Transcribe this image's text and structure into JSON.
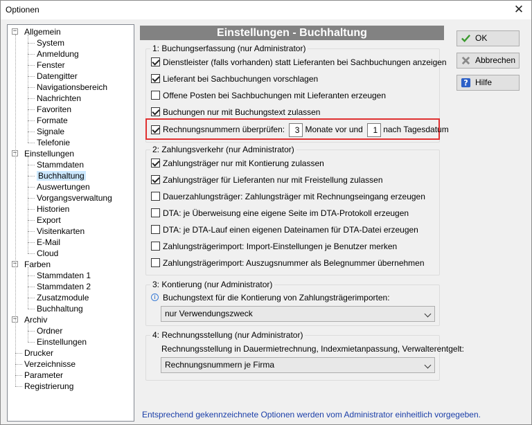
{
  "window": {
    "title": "Optionen",
    "close_glyph": "✕"
  },
  "tree": {
    "items": [
      {
        "label": "Allgemein",
        "level": 0,
        "expander": "−"
      },
      {
        "label": "System",
        "level": 1
      },
      {
        "label": "Anmeldung",
        "level": 1
      },
      {
        "label": "Fenster",
        "level": 1
      },
      {
        "label": "Datengitter",
        "level": 1
      },
      {
        "label": "Navigationsbereich",
        "level": 1
      },
      {
        "label": "Nachrichten",
        "level": 1
      },
      {
        "label": "Favoriten",
        "level": 1
      },
      {
        "label": "Formate",
        "level": 1
      },
      {
        "label": "Signale",
        "level": 1
      },
      {
        "label": "Telefonie",
        "level": 1
      },
      {
        "label": "Einstellungen",
        "level": 0,
        "expander": "−"
      },
      {
        "label": "Stammdaten",
        "level": 1
      },
      {
        "label": "Buchhaltung",
        "level": 1,
        "selected": true
      },
      {
        "label": "Auswertungen",
        "level": 1
      },
      {
        "label": "Vorgangsverwaltung",
        "level": 1
      },
      {
        "label": "Historien",
        "level": 1
      },
      {
        "label": "Export",
        "level": 1
      },
      {
        "label": "Visitenkarten",
        "level": 1
      },
      {
        "label": "E-Mail",
        "level": 1
      },
      {
        "label": "Cloud",
        "level": 1
      },
      {
        "label": "Farben",
        "level": 0,
        "expander": "−"
      },
      {
        "label": "Stammdaten 1",
        "level": 1
      },
      {
        "label": "Stammdaten 2",
        "level": 1
      },
      {
        "label": "Zusatzmodule",
        "level": 1
      },
      {
        "label": "Buchhaltung",
        "level": 1
      },
      {
        "label": "Archiv",
        "level": 0,
        "expander": "−"
      },
      {
        "label": "Ordner",
        "level": 1
      },
      {
        "label": "Einstellungen",
        "level": 1
      },
      {
        "label": "Drucker",
        "level": 0
      },
      {
        "label": "Verzeichnisse",
        "level": 0
      },
      {
        "label": "Parameter",
        "level": 0
      },
      {
        "label": "Registrierung",
        "level": 0
      }
    ]
  },
  "panel": {
    "title": "Einstellungen - Buchhaltung"
  },
  "group1": {
    "title": "1: Buchungserfassung  (nur Administrator)",
    "options": [
      {
        "label": "Dienstleister (falls vorhanden) statt Lieferanten bei Sachbuchungen anzeigen",
        "checked": true
      },
      {
        "label": "Lieferant bei Sachbuchungen vorschlagen",
        "checked": true
      },
      {
        "label": "Offene Posten bei Sachbuchungen mit Lieferanten erzeugen",
        "checked": false
      },
      {
        "label": "Buchungen nur mit Buchungstext zulassen",
        "checked": true
      }
    ],
    "check_row": {
      "label": "Rechnungsnummern überprüfen:",
      "checked": true,
      "months_before": "3",
      "mid_text": "Monate vor und",
      "months_after": "1",
      "end_text": "nach Tagesdatum"
    }
  },
  "group2": {
    "title": "2: Zahlungsverkehr  (nur Administrator)",
    "options": [
      {
        "label": "Zahlungsträger nur mit Kontierung zulassen",
        "checked": true
      },
      {
        "label": "Zahlungsträger für Lieferanten nur mit Freistellung zulassen",
        "checked": true
      },
      {
        "label": "Dauerzahlungsträger: Zahlungsträger mit Rechnungseingang erzeugen",
        "checked": false
      },
      {
        "label": "DTA: je Überweisung eine eigene Seite im DTA-Protokoll erzeugen",
        "checked": false
      },
      {
        "label": "DTA: je DTA-Lauf einen eigenen Dateinamen für DTA-Datei erzeugen",
        "checked": false
      },
      {
        "label": "Zahlungsträgerimport: Import-Einstellungen je Benutzer merken",
        "checked": false
      },
      {
        "label": "Zahlungsträgerimport: Auszugsnummer als Belegnummer übernehmen",
        "checked": false
      }
    ]
  },
  "group3": {
    "title": "3: Kontierung  (nur Administrator)",
    "info_label": "Buchungstext für die Kontierung von Zahlungsträgerimporten:",
    "select_value": "nur Verwendungszweck"
  },
  "group4": {
    "title": "4: Rechnungsstellung  (nur Administrator)",
    "label": "Rechnungsstellung in Dauermietrechnung, Indexmietanpassung, Verwalterentgelt:",
    "select_value": "Rechnungsnummern je Firma"
  },
  "buttons": {
    "ok": "OK",
    "cancel": "Abbrechen",
    "help": "Hilfe"
  },
  "footer": "Entsprechend gekennzeichnete Optionen werden vom Administrator einheitlich vorgegeben.",
  "colors": {
    "header_bg": "#828282",
    "highlight": "#e03030",
    "footer_text": "#1a3ea8",
    "selection": "#cce8ff"
  }
}
